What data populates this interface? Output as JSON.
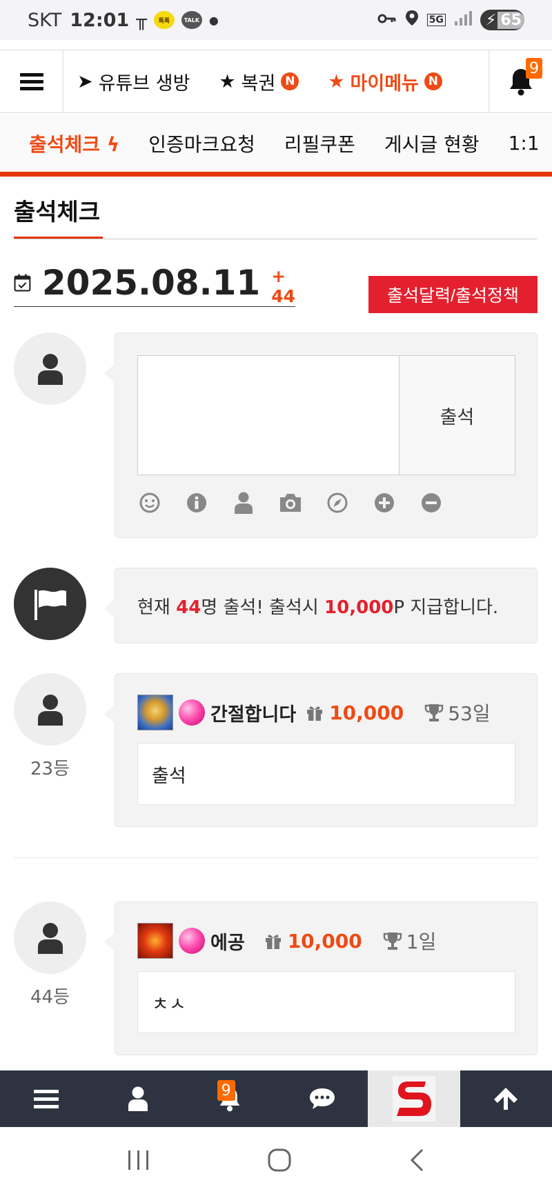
{
  "status_bar": {
    "carrier": "SKT",
    "time": "12:01",
    "network": "5G",
    "battery": "65"
  },
  "top_nav": {
    "items": [
      {
        "label": "유튜브 생방",
        "prefix": "★"
      },
      {
        "label": "복권",
        "prefix": "★",
        "badge": "N"
      },
      {
        "label": "마이메뉴",
        "prefix": "★",
        "badge": "N"
      }
    ],
    "notification_count": "9"
  },
  "sub_tabs": [
    {
      "label": "출석체크"
    },
    {
      "label": "인증마크요청"
    },
    {
      "label": "리필쿠폰"
    },
    {
      "label": "게시글 현황"
    },
    {
      "label": "1:1"
    }
  ],
  "section": {
    "title": "출석체크",
    "date": "2025.08.11",
    "count": "+ 44",
    "policy_button": "출석달력/출석정책"
  },
  "composer": {
    "textarea_value": "",
    "submit_label": "출석",
    "tools": [
      "smile-icon",
      "info-icon",
      "user-icon",
      "camera-icon",
      "compass-icon",
      "plus-circle-icon",
      "minus-circle-icon"
    ]
  },
  "notice": {
    "pre": "현재 ",
    "count": "44",
    "mid": "명 출석! 출석시 ",
    "points": "10,000",
    "post": "P 지급합니다."
  },
  "entries": [
    {
      "rank": "23등",
      "name": "간절합니다",
      "points": "10,000",
      "days": "53일",
      "comment": "출석"
    },
    {
      "rank": "44등",
      "name": "에공",
      "points": "10,000",
      "days": "1일",
      "comment": "ㅊㅅ"
    }
  ],
  "app_bar": {
    "notification_count": "9"
  },
  "colors": {
    "accent": "#ee4a14",
    "red": "#e5202e",
    "appbar": "#2d3340"
  }
}
